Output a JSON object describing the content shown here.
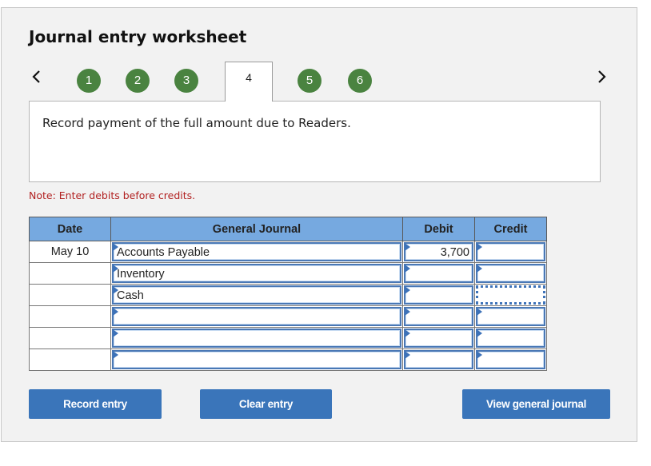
{
  "title": "Journal entry worksheet",
  "navigation": {
    "prev_icon": "chevron-left-icon",
    "next_icon": "chevron-right-icon",
    "steps": [
      {
        "label": "1",
        "state": "completed"
      },
      {
        "label": "2",
        "state": "completed"
      },
      {
        "label": "3",
        "state": "completed"
      },
      {
        "label": "4",
        "state": "active"
      },
      {
        "label": "5",
        "state": "completed"
      },
      {
        "label": "6",
        "state": "completed"
      }
    ]
  },
  "description": "Record payment of the full amount due to Readers.",
  "note": "Note: Enter debits before credits.",
  "table": {
    "headers": {
      "date": "Date",
      "account": "General Journal",
      "debit": "Debit",
      "credit": "Credit"
    },
    "rows": [
      {
        "date": "May 10",
        "account": "Accounts Payable",
        "debit": "3,700",
        "credit": ""
      },
      {
        "date": "",
        "account": "Inventory",
        "debit": "",
        "credit": ""
      },
      {
        "date": "",
        "account": "Cash",
        "debit": "",
        "credit": ""
      },
      {
        "date": "",
        "account": "",
        "debit": "",
        "credit": ""
      },
      {
        "date": "",
        "account": "",
        "debit": "",
        "credit": ""
      },
      {
        "date": "",
        "account": "",
        "debit": "",
        "credit": ""
      }
    ]
  },
  "buttons": {
    "record": "Record entry",
    "clear": "Clear entry",
    "view": "View general journal"
  },
  "colors": {
    "step_green": "#4a8340",
    "header_blue": "#76a9e0",
    "button_blue": "#3a75ba",
    "note_red": "#b22222"
  }
}
